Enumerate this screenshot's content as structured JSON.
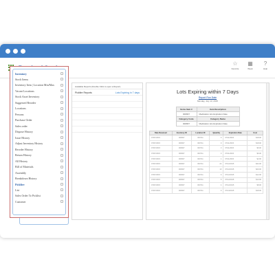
{
  "app": {
    "title": "Barcloud Stock"
  },
  "header_actions": [
    {
      "label": "Favorite",
      "icon": "star-icon",
      "glyph": "☆"
    },
    {
      "label": "Week",
      "icon": "calendar-icon",
      "glyph": "▦"
    },
    {
      "label": "Help",
      "icon": "help-icon",
      "glyph": "?"
    }
  ],
  "sidebar": {
    "sections": [
      {
        "title": "Inventory",
        "items": [
          "Stock Items",
          "Inventory Item | Location Min/Max",
          "Vacant Locations",
          "Stock Asset Inventory",
          "Suggested Reorder",
          "Locations",
          "Persons",
          "Purchase Order",
          "Sales order",
          "Dispose History",
          "Issue History",
          "Adjust Inventory History",
          "Reorder History",
          "Return History",
          "All History",
          "Bill of Materials",
          "Assembly",
          "Breakdown History"
        ]
      },
      {
        "title": "Pickfire",
        "items": [
          "List",
          "Sales Order To Picklist",
          "Customer"
        ]
      }
    ]
  },
  "middle": {
    "hint": "Available Reports (Double Click to open a Report)",
    "rows": [
      {
        "name": "Pickfire Reports",
        "link": "Lots Expiring in 7 days"
      }
    ]
  },
  "report": {
    "title": "Lots Expiring within 7 Days",
    "subtitle": "Report Run Date",
    "date": "Monday, July 13, 2015",
    "criteria": {
      "headers": [
        "Items Item #",
        "Item Description"
      ],
      "row": [
        "000667",
        "Medication lots Expiration Date"
      ],
      "headers2": [
        "Category Code",
        "Category Name"
      ],
      "row2": [
        "000667",
        "Medication lots Expiration Date"
      ]
    },
    "columns": [
      "Date Received",
      "Inventory ID",
      "Location ID",
      "Quantity",
      "Expiration Date",
      "Cost"
    ],
    "rows": [
      [
        "07/07/2015",
        "000667",
        "000711",
        "9",
        "07/11/2015",
        "$18.00"
      ],
      [
        "07/07/2015",
        "000667",
        "000711",
        "9",
        "07/11/2015",
        "$18.00"
      ],
      [
        "07/07/2015",
        "000667",
        "000711",
        "3",
        "07/11/2015",
        "$6.00"
      ],
      [
        "07/07/2015",
        "000667",
        "000711",
        "3",
        "07/11/2015",
        "$6.00"
      ],
      [
        "07/07/2015",
        "000667",
        "000711",
        "1",
        "07/11/2015",
        "$2.00"
      ],
      [
        "07/07/2015",
        "000667",
        "000711",
        "22",
        "07/12/2015",
        "$44.00"
      ],
      [
        "07/07/2015",
        "000667",
        "000711",
        "10",
        "07/12/2015",
        "$20.00"
      ],
      [
        "07/07/2015",
        "000667",
        "000711",
        "6",
        "07/12/2015",
        "$12.00"
      ],
      [
        "07/07/2015",
        "000667",
        "000711",
        "5",
        "07/12/2015",
        "$10.00"
      ],
      [
        "07/07/2015",
        "000667",
        "000711",
        "4",
        "07/12/2015",
        "$8.00"
      ],
      [
        "07/07/2015",
        "000667",
        "000711",
        "9",
        "07/13/2015",
        "$18.00"
      ]
    ]
  },
  "colors": {
    "chrome": "#3f7fc8",
    "brand": "#2a5fa8",
    "highlight": "#c86a6a"
  }
}
